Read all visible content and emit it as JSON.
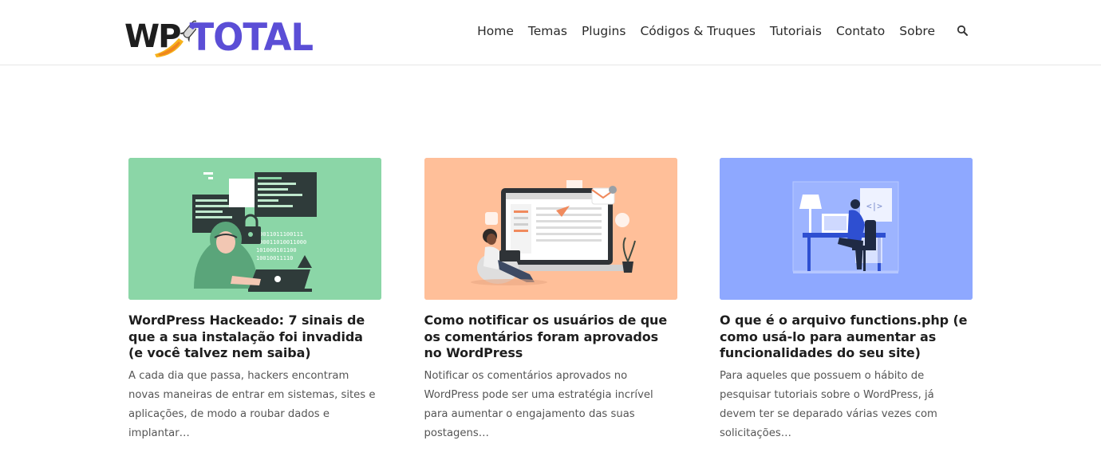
{
  "header": {
    "logo": {
      "part1": "WP",
      "part2": "TOTAL"
    },
    "nav": [
      "Home",
      "Temas",
      "Plugins",
      "Códigos & Truques",
      "Tutoriais",
      "Contato",
      "Sobre"
    ]
  },
  "colors": {
    "accent": "#5b4ed6",
    "card1_bg": "#8bd6a7",
    "card2_bg": "#ffbf99",
    "card3_bg": "#8ea8ff"
  },
  "posts": [
    {
      "title": "WordPress Hackeado: 7 sinais de que a sua instalação foi invadida (e você talvez nem saiba)",
      "excerpt": "A cada dia que passa, hackers encontram novas maneiras de entrar em sistemas, sites e aplicações, de modo a roubar dados e implantar…",
      "image_icon": "hacker-illustration"
    },
    {
      "title": "Como notificar os usuários de que os comentários foram aprovados no WordPress",
      "excerpt": "Notificar os comentários aprovados no WordPress pode ser uma estratégia incrível para aumentar o engajamento das suas postagens…",
      "image_icon": "laptop-notification-illustration"
    },
    {
      "title": "O que é o arquivo functions.php (e como usá-lo para aumentar as funcionalidades do seu site)",
      "excerpt": "Para aqueles que possuem o hábito de pesquisar tutoriais sobre o WordPress, já devem ter se deparado várias vezes com solicitações…",
      "image_icon": "developer-desk-illustration"
    }
  ]
}
